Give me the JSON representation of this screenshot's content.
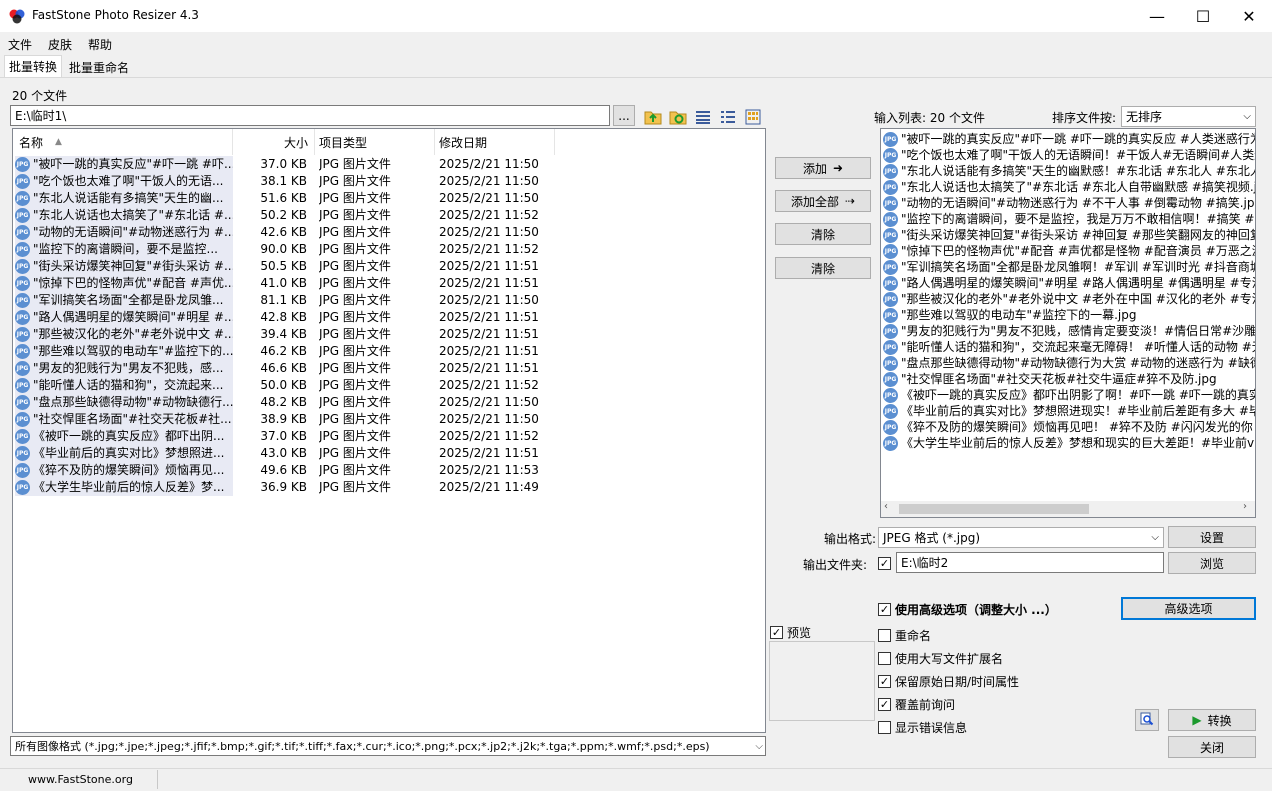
{
  "window": {
    "title": "FastStone Photo Resizer 4.3",
    "minimize": "—",
    "maximize": "☐",
    "close": "✕"
  },
  "menu": [
    "文件",
    "皮肤",
    "帮助"
  ],
  "tabs": [
    "批量转换",
    "批量重命名"
  ],
  "source": {
    "file_count": "20 个文件",
    "path": "E:\\临时1\\",
    "browse_label": "...",
    "filter": "所有图像格式 (*.jpg;*.jpe;*.jpeg;*.jfif;*.bmp;*.gif;*.tif;*.tiff;*.fax;*.cur;*.ico;*.png;*.pcx;*.jp2;*.j2k;*.tga;*.ppm;*.wmf;*.psd;*.eps)"
  },
  "toolbar_icons": [
    "folder-up-icon",
    "folder-refresh-icon",
    "details-view-icon",
    "list-view-icon",
    "thumbnail-view-icon"
  ],
  "table": {
    "headers": [
      "名称",
      "大小",
      "项目类型",
      "修改日期"
    ],
    "rows": [
      {
        "name": "\"被吓一跳的真实反应\"#吓一跳 #吓...",
        "size": "37.0 KB",
        "type": "JPG 图片文件",
        "date": "2025/2/21 11:50"
      },
      {
        "name": "\"吃个饭也太难了啊\"干饭人的无语...",
        "size": "38.1 KB",
        "type": "JPG 图片文件",
        "date": "2025/2/21 11:50"
      },
      {
        "name": "\"东北人说话能有多搞笑\"天生的幽...",
        "size": "51.6 KB",
        "type": "JPG 图片文件",
        "date": "2025/2/21 11:50"
      },
      {
        "name": "\"东北人说话也太搞笑了\"#东北话 #...",
        "size": "50.2 KB",
        "type": "JPG 图片文件",
        "date": "2025/2/21 11:52"
      },
      {
        "name": "\"动物的无语瞬间\"#动物迷惑行为 #...",
        "size": "42.6 KB",
        "type": "JPG 图片文件",
        "date": "2025/2/21 11:50"
      },
      {
        "name": "\"监控下的离谱瞬间，要不是监控...",
        "size": "90.0 KB",
        "type": "JPG 图片文件",
        "date": "2025/2/21 11:52"
      },
      {
        "name": "\"街头采访爆笑神回复\"#街头采访 #...",
        "size": "50.5 KB",
        "type": "JPG 图片文件",
        "date": "2025/2/21 11:51"
      },
      {
        "name": "\"惊掉下巴的怪物声优\"#配音 #声优...",
        "size": "41.0 KB",
        "type": "JPG 图片文件",
        "date": "2025/2/21 11:51"
      },
      {
        "name": "\"军训搞笑名场面\"全都是卧龙凤雏...",
        "size": "81.1 KB",
        "type": "JPG 图片文件",
        "date": "2025/2/21 11:50"
      },
      {
        "name": "\"路人偶遇明星的爆笑瞬间\"#明星 #...",
        "size": "42.8 KB",
        "type": "JPG 图片文件",
        "date": "2025/2/21 11:51"
      },
      {
        "name": "\"那些被汉化的老外\"#老外说中文 #...",
        "size": "39.4 KB",
        "type": "JPG 图片文件",
        "date": "2025/2/21 11:51"
      },
      {
        "name": "\"那些难以驾驭的电动车\"#监控下的...",
        "size": "46.2 KB",
        "type": "JPG 图片文件",
        "date": "2025/2/21 11:51"
      },
      {
        "name": "\"男友的犯贱行为\"男友不犯贱，感...",
        "size": "46.6 KB",
        "type": "JPG 图片文件",
        "date": "2025/2/21 11:51"
      },
      {
        "name": "\"能听懂人话的猫和狗\"，交流起来...",
        "size": "50.0 KB",
        "type": "JPG 图片文件",
        "date": "2025/2/21 11:52"
      },
      {
        "name": "\"盘点那些缺德得动物\"#动物缺德行...",
        "size": "48.2 KB",
        "type": "JPG 图片文件",
        "date": "2025/2/21 11:50"
      },
      {
        "name": "\"社交悍匪名场面\"#社交天花板#社...",
        "size": "38.9 KB",
        "type": "JPG 图片文件",
        "date": "2025/2/21 11:50"
      },
      {
        "name": "《被吓一跳的真实反应》都吓出阴...",
        "size": "37.0 KB",
        "type": "JPG 图片文件",
        "date": "2025/2/21 11:52"
      },
      {
        "name": "《毕业前后的真实对比》梦想照进...",
        "size": "43.0 KB",
        "type": "JPG 图片文件",
        "date": "2025/2/21 11:51"
      },
      {
        "name": "《猝不及防的爆笑瞬间》烦恼再见...",
        "size": "49.6 KB",
        "type": "JPG 图片文件",
        "date": "2025/2/21 11:53"
      },
      {
        "name": "《大学生毕业前后的惊人反差》梦...",
        "size": "36.9 KB",
        "type": "JPG 图片文件",
        "date": "2025/2/21 11:49"
      }
    ]
  },
  "middle_buttons": {
    "add": "添加",
    "add_all": "添加全部",
    "clear": "清除",
    "clear_all": "清除",
    "preview_label": "预览"
  },
  "input_list": {
    "label": "输入列表: 20 个文件",
    "sort_label": "排序文件按:",
    "sort_value": "无排序",
    "items": [
      "\"被吓一跳的真实反应\"#吓一跳 #吓一跳的真实反应 #人类迷惑行为",
      "\"吃个饭也太难了啊\"干饭人的无语瞬间！#干饭人#无语瞬间#人类迷",
      "\"东北人说话能有多搞笑\"天生的幽默感！#东北话 #东北人 #东北人",
      "\"东北人说话也太搞笑了\"#东北话 #东北人自带幽默感 #搞笑视频.jp",
      "\"动物的无语瞬间\"#动物迷惑行为 #不干人事 #倒霉动物 #搞笑.jpg",
      "\"监控下的离谱瞬间，要不是监控，我是万万不敢相信啊！#搞笑 #",
      "\"街头采访爆笑神回复\"#街头采访 #神回复 #那些笑翻网友的神回复",
      "\"惊掉下巴的怪物声优\"#配音 #声优都是怪物 #配音演员 #万恶之源",
      "\"军训搞笑名场面\"全都是卧龙凤雏啊！#军训 #军训时光 #抖音商城",
      "\"路人偶遇明星的爆笑瞬间\"#明星 #路人偶遇明星 #偶遇明星 #专治",
      "\"那些被汉化的老外\"#老外说中文 #老外在中国 #汉化的老外 #专治",
      "\"那些难以驾驭的电动车\"#监控下的一幕.jpg",
      "\"男友的犯贱行为\"男友不犯贱，感情肯定要变淡！#情侣日常#沙雕",
      "\"能听懂人话的猫和狗\"，交流起来毫无障碍！ #听懂人话的动物 #无",
      "\"盘点那些缺德得动物\"#动物缺德行为大赏 #动物的迷惑行为 #缺德",
      "\"社交悍匪名场面\"#社交天花板#社交牛逼症#猝不及防.jpg",
      "《被吓一跳的真实反应》都吓出阴影了啊！#吓一跳 #吓一跳的真实",
      "《毕业前后的真实对比》梦想照进现实！#毕业前后差距有多大 #毕",
      "《猝不及防的爆笑瞬间》烦恼再见吧！ #猝不及防 #闪闪发光的你",
      "《大学生毕业前后的惊人反差》梦想和现实的巨大差距！#毕业前v"
    ]
  },
  "output": {
    "format_label": "输出格式:",
    "format_value": "JPEG 格式 (*.jpg)",
    "settings_button": "设置",
    "folder_label": "输出文件夹:",
    "folder_value": "E:\\临时2",
    "browse_button": "浏览"
  },
  "options": {
    "advanced_check": "使用高级选项（调整大小 ...）",
    "advanced_button": "高级选项",
    "rename": "重命名",
    "uppercase_ext": "使用大写文件扩展名",
    "keep_date": "保留原始日期/时间属性",
    "overwrite_ask": "覆盖前询问",
    "show_errors": "显示错误信息",
    "convert_button": "转换",
    "close_button": "关闭"
  },
  "statusbar": {
    "website": "www.FastStone.org"
  },
  "colors": {
    "accent": "#0078d7",
    "window_bg": "#f0f0f0",
    "selected_row": "#e8eaf4"
  }
}
